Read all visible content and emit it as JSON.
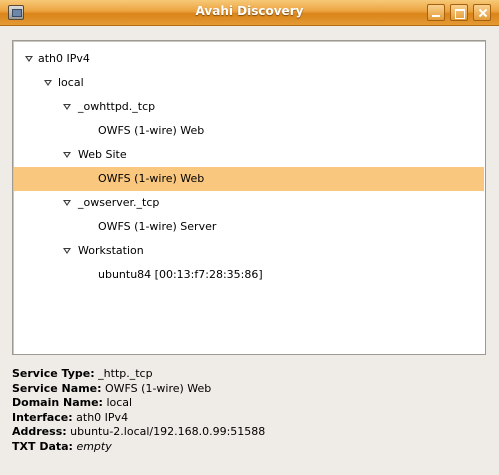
{
  "window": {
    "title": "Avahi Discovery"
  },
  "tree": {
    "rows": [
      {
        "label": "ath0 IPv4",
        "expanded": true
      },
      {
        "label": "local",
        "expanded": true
      },
      {
        "label": "_owhttpd._tcp",
        "expanded": true
      },
      {
        "label": "OWFS (1-wire) Web"
      },
      {
        "label": "Web Site",
        "expanded": true
      },
      {
        "label": "OWFS (1-wire) Web",
        "selected": true
      },
      {
        "label": "_owserver._tcp",
        "expanded": true
      },
      {
        "label": "OWFS (1-wire) Server"
      },
      {
        "label": "Workstation",
        "expanded": true
      },
      {
        "label": "ubuntu84 [00:13:f7:28:35:86]"
      }
    ],
    "selection_color": "#f9c77e"
  },
  "details": {
    "service_type": {
      "key": "Service Type:",
      "value": "_http._tcp"
    },
    "service_name": {
      "key": "Service Name:",
      "value": "OWFS (1-wire) Web"
    },
    "domain_name": {
      "key": "Domain Name:",
      "value": "local"
    },
    "interface": {
      "key": "Interface:",
      "value": "ath0 IPv4"
    },
    "address": {
      "key": "Address:",
      "value": "ubuntu-2.local/192.168.0.99:51588"
    },
    "txt_data": {
      "key": "TXT Data:",
      "value": "empty"
    }
  },
  "colors": {
    "titlebar": "#e59a34",
    "window_bg": "#efebe7"
  }
}
